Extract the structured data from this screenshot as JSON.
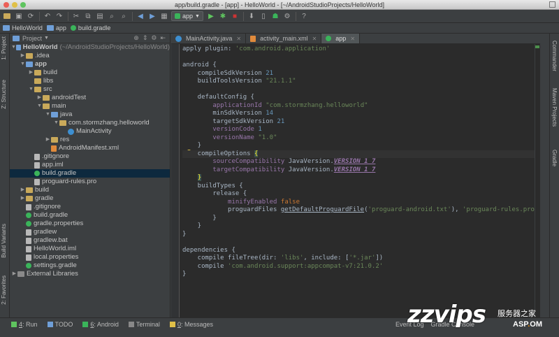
{
  "window": {
    "title": "app/build.gradle - [app] - HelloWorld - [~/AndroidStudioProjects/HelloWorld]"
  },
  "colors": {
    "red": "#ec5f57",
    "yellow": "#e0c048",
    "green": "#5fc45f",
    "accent": "#0d293e"
  },
  "toolbar": {
    "run_config": "app"
  },
  "navbar": {
    "crumbs": [
      "HelloWorld",
      "app",
      "build.gradle"
    ]
  },
  "project_panel": {
    "header": "Project",
    "rows": [
      {
        "label": "HelloWorld",
        "extra": "(~/AndroidStudioProjects/HelloWorld)",
        "depth": 0,
        "icon": "folder-blue",
        "arrow": "▼",
        "bold": true
      },
      {
        "label": ".idea",
        "depth": 1,
        "icon": "folder",
        "arrow": "▶"
      },
      {
        "label": "app",
        "depth": 1,
        "icon": "folder-blue",
        "arrow": "▼",
        "bold": true
      },
      {
        "label": "build",
        "depth": 2,
        "icon": "folder",
        "arrow": "▶"
      },
      {
        "label": "libs",
        "depth": 2,
        "icon": "folder",
        "arrow": ""
      },
      {
        "label": "src",
        "depth": 2,
        "icon": "folder",
        "arrow": "▼"
      },
      {
        "label": "androidTest",
        "depth": 3,
        "icon": "folder",
        "arrow": "▶"
      },
      {
        "label": "main",
        "depth": 3,
        "icon": "folder",
        "arrow": "▼"
      },
      {
        "label": "java",
        "depth": 4,
        "icon": "folder-blue",
        "arrow": "▼"
      },
      {
        "label": "com.stormzhang.helloworld",
        "depth": 5,
        "icon": "folder",
        "arrow": "▼"
      },
      {
        "label": "MainActivity",
        "depth": 6,
        "icon": "class",
        "arrow": ""
      },
      {
        "label": "res",
        "depth": 4,
        "icon": "folder",
        "arrow": "▶"
      },
      {
        "label": "AndroidManifest.xml",
        "depth": 4,
        "icon": "xml",
        "arrow": ""
      },
      {
        "label": ".gitignore",
        "depth": 2,
        "icon": "file",
        "arrow": ""
      },
      {
        "label": "app.iml",
        "depth": 2,
        "icon": "file",
        "arrow": ""
      },
      {
        "label": "build.gradle",
        "depth": 2,
        "icon": "gradle",
        "arrow": "",
        "selected": true
      },
      {
        "label": "proguard-rules.pro",
        "depth": 2,
        "icon": "file",
        "arrow": ""
      },
      {
        "label": "build",
        "depth": 1,
        "icon": "folder",
        "arrow": "▶"
      },
      {
        "label": "gradle",
        "depth": 1,
        "icon": "folder",
        "arrow": "▶"
      },
      {
        "label": ".gitignore",
        "depth": 1,
        "icon": "file",
        "arrow": ""
      },
      {
        "label": "build.gradle",
        "depth": 1,
        "icon": "gradle",
        "arrow": ""
      },
      {
        "label": "gradle.properties",
        "depth": 1,
        "icon": "gradle",
        "arrow": ""
      },
      {
        "label": "gradlew",
        "depth": 1,
        "icon": "file",
        "arrow": ""
      },
      {
        "label": "gradlew.bat",
        "depth": 1,
        "icon": "file",
        "arrow": ""
      },
      {
        "label": "HelloWorld.iml",
        "depth": 1,
        "icon": "file",
        "arrow": ""
      },
      {
        "label": "local.properties",
        "depth": 1,
        "icon": "file",
        "arrow": ""
      },
      {
        "label": "settings.gradle",
        "depth": 1,
        "icon": "gradle",
        "arrow": ""
      },
      {
        "label": "External Libraries",
        "depth": 0,
        "icon": "lib",
        "arrow": "▶"
      }
    ]
  },
  "left_tool_tabs": [
    "1: Project",
    "Z: Structure",
    "Build Variants",
    "2: Favorites"
  ],
  "right_tool_tabs": [
    "Commander",
    "Maven Projects",
    "Gradle"
  ],
  "editor_tabs": [
    {
      "label": "MainActivity.java",
      "icon": "class"
    },
    {
      "label": "activity_main.xml",
      "icon": "xml"
    },
    {
      "label": "app",
      "icon": "gradle",
      "active": true
    }
  ],
  "code_lines": [
    [
      {
        "t": "apply plugin: "
      },
      {
        "t": "'com.android.application'",
        "c": "str"
      }
    ],
    [],
    [
      {
        "t": "android {"
      }
    ],
    [
      {
        "t": "    compileSdkVersion "
      },
      {
        "t": "21",
        "c": "num"
      }
    ],
    [
      {
        "t": "    buildToolsVersion "
      },
      {
        "t": "\"21.1.1\"",
        "c": "str"
      }
    ],
    [],
    [
      {
        "t": "    defaultConfig {"
      }
    ],
    [
      {
        "t": "        "
      },
      {
        "t": "applicationId",
        "c": "prop"
      },
      {
        "t": " "
      },
      {
        "t": "\"com.stormzhang.helloworld\"",
        "c": "str"
      }
    ],
    [
      {
        "t": "        minSdkVersion "
      },
      {
        "t": "14",
        "c": "num"
      }
    ],
    [
      {
        "t": "        targetSdkVersion "
      },
      {
        "t": "21",
        "c": "num"
      }
    ],
    [
      {
        "t": "        "
      },
      {
        "t": "versionCode",
        "c": "prop"
      },
      {
        "t": " "
      },
      {
        "t": "1",
        "c": "num"
      }
    ],
    [
      {
        "t": "        "
      },
      {
        "t": "versionName",
        "c": "prop"
      },
      {
        "t": " "
      },
      {
        "t": "\"1.0\"",
        "c": "str"
      }
    ],
    [
      {
        "t": "    }"
      }
    ],
    [
      {
        "t": "    compileOptions "
      },
      {
        "t": "{",
        "c": "bracket"
      }
    ],
    [
      {
        "t": "        "
      },
      {
        "t": "sourceCompatibility",
        "c": "prop"
      },
      {
        "t": " JavaVersion."
      },
      {
        "t": "VERSION_1_7",
        "c": "fld"
      }
    ],
    [
      {
        "t": "        "
      },
      {
        "t": "targetCompatibility",
        "c": "prop"
      },
      {
        "t": " JavaVersion."
      },
      {
        "t": "VERSION_1_7",
        "c": "fld"
      }
    ],
    [
      {
        "t": "    "
      },
      {
        "t": "}",
        "c": "bracket"
      }
    ],
    [
      {
        "t": "    buildTypes {"
      }
    ],
    [
      {
        "t": "        release {"
      }
    ],
    [
      {
        "t": "            "
      },
      {
        "t": "minifyEnabled",
        "c": "prop"
      },
      {
        "t": " "
      },
      {
        "t": "false",
        "c": "kw"
      }
    ],
    [
      {
        "t": "            proguardFiles "
      },
      {
        "t": "getDefaultProguardFile",
        "c": "meth"
      },
      {
        "t": "("
      },
      {
        "t": "'proguard-android.txt'",
        "c": "str"
      },
      {
        "t": "), "
      },
      {
        "t": "'proguard-rules.pro'",
        "c": "str"
      }
    ],
    [
      {
        "t": "        }"
      }
    ],
    [
      {
        "t": "    }"
      }
    ],
    [
      {
        "t": "}"
      }
    ],
    [],
    [
      {
        "t": "dependencies {"
      }
    ],
    [
      {
        "t": "    compile fileTree(dir: "
      },
      {
        "t": "'libs'",
        "c": "str"
      },
      {
        "t": ", include: ["
      },
      {
        "t": "'*.jar'",
        "c": "str"
      },
      {
        "t": "])"
      }
    ],
    [
      {
        "t": "    compile "
      },
      {
        "t": "'com.android.support:appcompat-v7:21.0.2'",
        "c": "str"
      }
    ],
    [
      {
        "t": "}"
      }
    ]
  ],
  "status_tabs": [
    {
      "num": "4",
      "label": ": Run",
      "icon_color": "#5fc45f"
    },
    {
      "num": "",
      "label": "TODO",
      "icon_color": "#6f9fd8"
    },
    {
      "num": "6",
      "label": ": Android",
      "icon_color": "#3ab45a"
    },
    {
      "num": "",
      "label": "Terminal",
      "icon_color": "#888888"
    },
    {
      "num": "0",
      "label": ": Messages",
      "icon_color": "#e0c048"
    }
  ],
  "status_right": [
    "Event Log",
    "Gradle Console"
  ],
  "watermark": {
    "logo": "zzvips",
    "cn": "服务器之家",
    "domain_pre": "ASP",
    "domain_mid": ".",
    "domain_post": "OM"
  }
}
